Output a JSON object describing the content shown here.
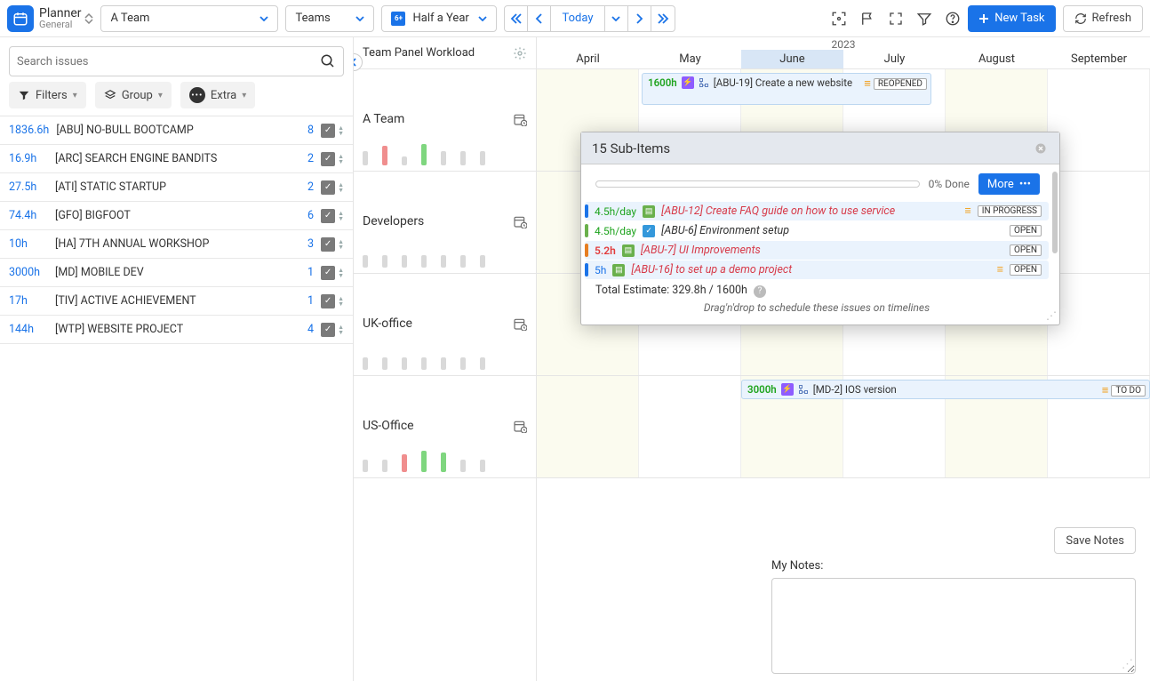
{
  "app": {
    "name": "Planner",
    "subtitle": "General"
  },
  "toolbar": {
    "team_select": "A Team",
    "scope_select": "Teams",
    "range_select": "Half a Year",
    "today": "Today",
    "new_task": "New Task",
    "refresh": "Refresh"
  },
  "search_placeholder": "Search issues",
  "filter_chips": {
    "filters": "Filters",
    "group": "Group",
    "extra": "Extra"
  },
  "issues": [
    {
      "hours": "1836.6h",
      "label": "[ABU] NO-BULL BOOTCAMP",
      "count": "8"
    },
    {
      "hours": "16.9h",
      "label": "[ARC] SEARCH ENGINE BANDITS",
      "count": "2"
    },
    {
      "hours": "27.5h",
      "label": "[ATI] STATIC STARTUP",
      "count": "2"
    },
    {
      "hours": "74.4h",
      "label": "[GFO] BIGFOOT",
      "count": "6"
    },
    {
      "hours": "10h",
      "label": "[HA] 7TH ANNUAL WORKSHOP",
      "count": "3"
    },
    {
      "hours": "3000h",
      "label": "[MD] MOBILE DEV",
      "count": "1"
    },
    {
      "hours": "17h",
      "label": "[TIV] ACTIVE ACHIEVEMENT",
      "count": "1"
    },
    {
      "hours": "144h",
      "label": "[WTP] WEBSITE PROJECT",
      "count": "4"
    }
  ],
  "panel_title": "Team Panel Workload",
  "teams": [
    {
      "name": "A Team"
    },
    {
      "name": "Developers"
    },
    {
      "name": "UK-office"
    },
    {
      "name": "US-Office"
    }
  ],
  "timeline": {
    "year": "2023",
    "months": [
      "April",
      "May",
      "June",
      "July",
      "August",
      "September"
    ],
    "current": "June"
  },
  "cards": {
    "abu19": {
      "hours": "1600h",
      "title": "[ABU-19] Create a new website",
      "status": "REOPENED"
    },
    "md2": {
      "hours": "3000h",
      "title": "[MD-2] IOS version",
      "status": "TO DO"
    }
  },
  "popup": {
    "title": "15 Sub-Items",
    "done": "0% Done",
    "more": "More",
    "items": [
      {
        "h": "4.5h/day",
        "title": "[ABU-12] Create FAQ guide on how to use service",
        "badge": "IN PROGRESS",
        "stripe": "#1a73e8",
        "hcolor": "green",
        "redtxt": true,
        "icon": "note",
        "bg": true,
        "hamb": true
      },
      {
        "h": "4.5h/day",
        "title": "[ABU-6] Environment setup",
        "badge": "OPEN",
        "stripe": "#6ab04c",
        "hcolor": "green",
        "redtxt": false,
        "icon": "check",
        "bg": false,
        "hamb": false
      },
      {
        "h": "5.2h",
        "title": "[ABU-7] UI Improvements",
        "badge": "OPEN",
        "stripe": "#e67e22",
        "hcolor": "red",
        "redtxt": true,
        "icon": "note",
        "bg": true,
        "hamb": false
      },
      {
        "h": "5h",
        "title": "[ABU-16] to set up a demo project",
        "badge": "OPEN",
        "stripe": "#1a73e8",
        "hcolor": "blue",
        "redtxt": true,
        "icon": "note",
        "bg": true,
        "hamb": true
      }
    ],
    "total": "Total Estimate: 329.8h / 1600h",
    "hint": "Drag'n'drop to schedule these issues on timelines"
  },
  "notes": {
    "label": "My Notes:",
    "save": "Save Notes"
  }
}
